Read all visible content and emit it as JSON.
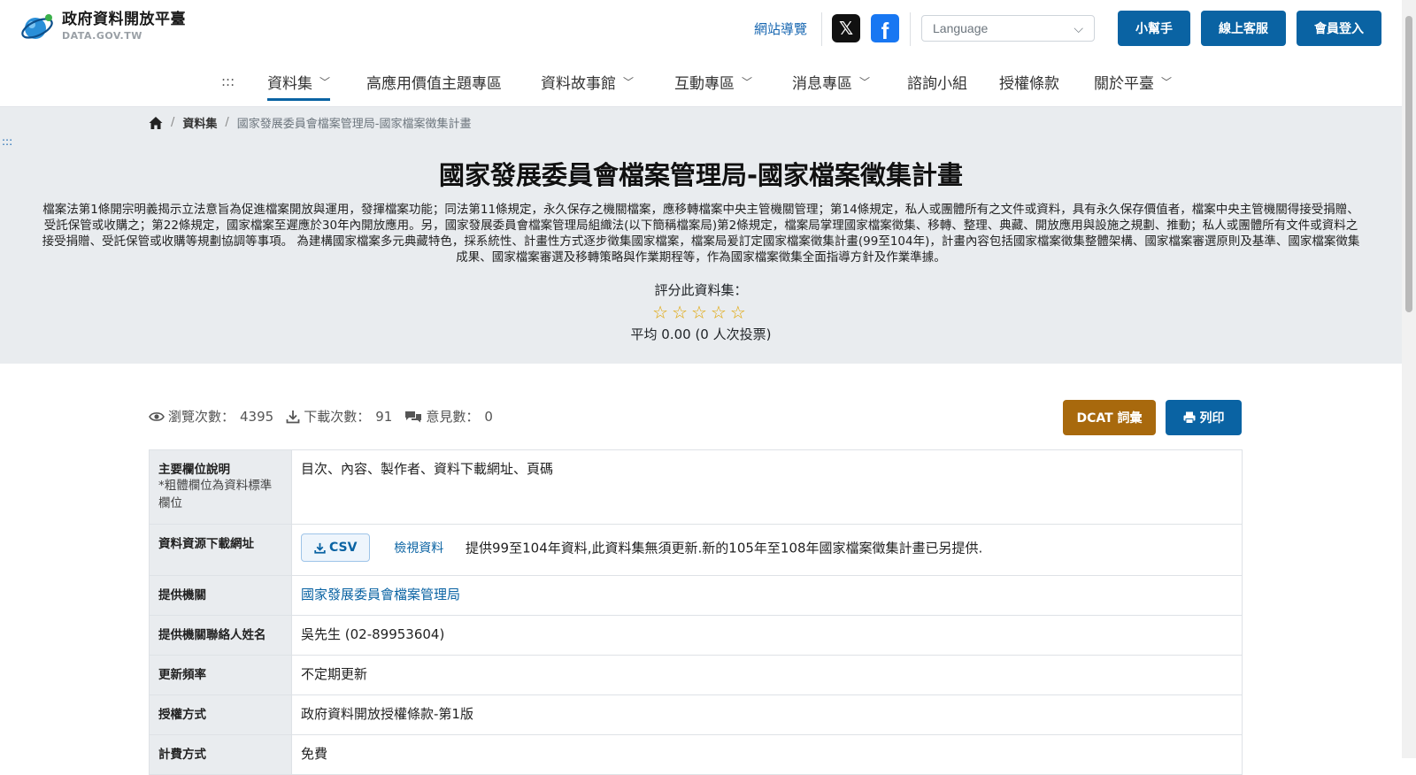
{
  "header": {
    "logo_zh": "政府資料開放平臺",
    "logo_en": "DATA.GOV.TW",
    "sitemap_label": "網站導覽",
    "language_placeholder": "Language",
    "helper_label": "小幫手",
    "service_label": "線上客服",
    "login_label": "會員登入"
  },
  "nav": {
    "anchor": ":::",
    "items": [
      "資料集",
      "高應用價值主題專區",
      "資料故事館",
      "互動專區",
      "消息專區",
      "諮詢小組",
      "授權條款",
      "關於平臺"
    ]
  },
  "breadcrumb": {
    "level1": "資料集",
    "current": "國家發展委員會檔案管理局-國家檔案徵集計畫"
  },
  "hero": {
    "anchor": ":::",
    "title": "國家發展委員會檔案管理局-國家檔案徵集計畫",
    "description": "檔案法第1條開宗明義揭示立法意旨為促進檔案開放與運用，發揮檔案功能；同法第11條規定，永久保存之機關檔案，應移轉檔案中央主管機關管理；第14條規定，私人或團體所有之文件或資料，具有永久保存價值者，檔案中央主管機關得接受捐贈、受託保管或收購之；第22條規定，國家檔案至遲應於30年內開放應用。另，國家發展委員會檔案管理局組織法(以下簡稱檔案局)第2條規定，檔案局掌理國家檔案徵集、移轉、整理、典藏、開放應用與設施之規劃、推動；私人或團體所有文件或資料之接受捐贈、受託保管或收購等規劃協調等事項。 為建構國家檔案多元典藏特色，採系統性、計畫性方式逐步徵集國家檔案，檔案局爰訂定國家檔案徵集計畫(99至104年)，計畫內容包括國家檔案徵集整體架構、國家檔案審選原則及基準、國家檔案徵集成果、國家檔案審選及移轉策略與作業期程等，作為國家檔案徵集全面指導方針及作業準據。",
    "rate_label": "評分此資料集：",
    "stars": "☆☆☆☆☆",
    "rating_average": "平均 0.00 (0 人次投票)"
  },
  "stats": {
    "views_label": "瀏覽次數：",
    "views": "4395",
    "downloads_label": "下載次數：",
    "downloads": "91",
    "comments_label": "意見數：",
    "comments": "0",
    "dcat_label": "DCAT 詞彙",
    "print_label": "列印"
  },
  "details": {
    "fields_label": "主要欄位說明",
    "fields_note": "*粗體欄位為資料標準欄位",
    "fields_value": "目次、內容、製作者、資料下載網址、頁碼",
    "resource_label": "資料資源下載網址",
    "csv_label": "CSV",
    "view_label": "檢視資料",
    "resource_desc": "提供99至104年資料,此資料集無須更新.新的105年至108年國家檔案徵集計畫已另提供.",
    "provider_label": "提供機關",
    "provider_value": "國家發展委員會檔案管理局",
    "contact_label": "提供機關聯絡人姓名",
    "contact_value": "吳先生 (02-89953604)",
    "frequency_label": "更新頻率",
    "frequency_value": "不定期更新",
    "license_label": "授權方式",
    "license_value": "政府資料開放授權條款-第1版",
    "fee_label": "計費方式",
    "fee_value": "免費"
  },
  "colors": {
    "primary": "#0a63a3",
    "dcat": "#a8690d",
    "hero_bg": "#e9ecef"
  }
}
